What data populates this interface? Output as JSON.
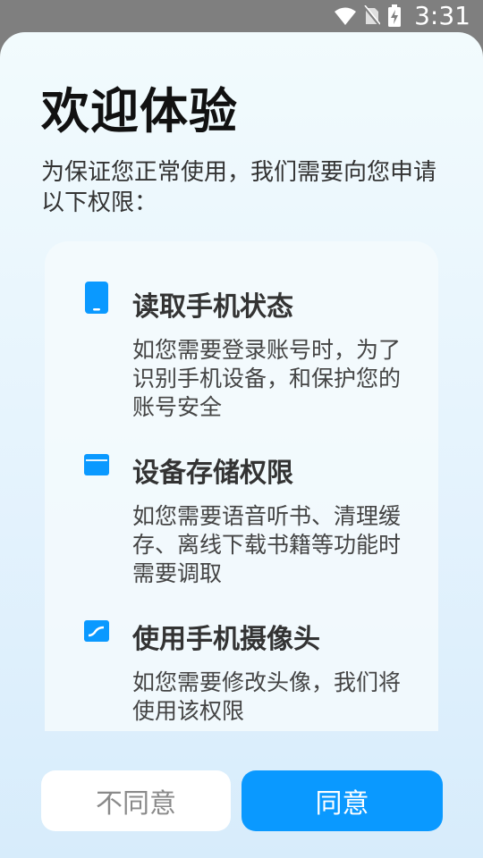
{
  "status_bar": {
    "time": "3:31",
    "icons": [
      "wifi-icon",
      "no-sim-icon",
      "battery-charging-icon"
    ]
  },
  "dialog": {
    "title": "欢迎体验",
    "intro": "为保证您正常使用，我们需要向您申请以下权限：",
    "permissions": [
      {
        "icon": "phone-icon",
        "title": "读取手机状态",
        "description": "如您需要登录账号时，为了识别手机设备，和保护您的账号安全"
      },
      {
        "icon": "storage-icon",
        "title": "设备存储权限",
        "description": "如您需要语音听书、清理缓存、离线下载书籍等功能时需要调取"
      },
      {
        "icon": "camera-icon",
        "title": "使用手机摄像头",
        "description": "如您需要修改头像，我们将使用该权限"
      }
    ],
    "buttons": {
      "disagree": "不同意",
      "agree": "同意"
    }
  },
  "colors": {
    "accent": "#0a99ff",
    "title": "#111111",
    "text": "#333333",
    "status_bar_bg": "#7f7f7f"
  }
}
